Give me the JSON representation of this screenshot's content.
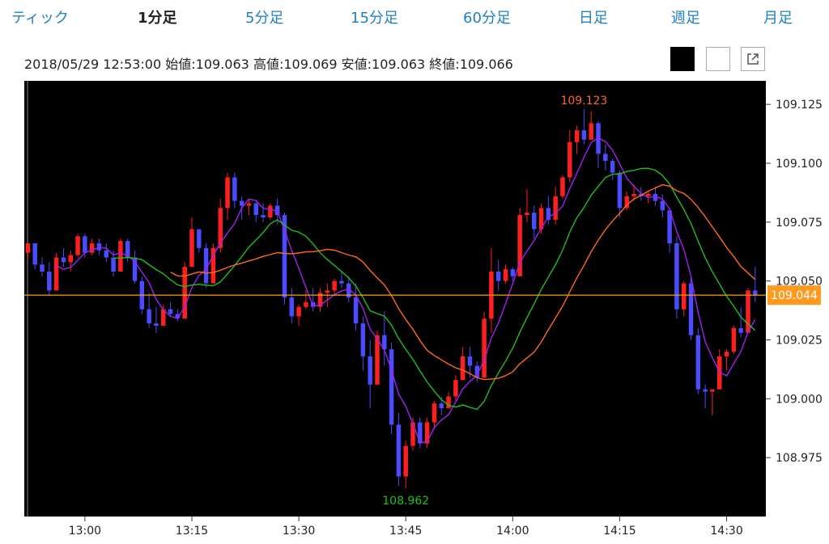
{
  "tabs": [
    {
      "label": "ティック",
      "active": false
    },
    {
      "label": "1分足",
      "active": true
    },
    {
      "label": "5分足",
      "active": false
    },
    {
      "label": "15分足",
      "active": false
    },
    {
      "label": "60分足",
      "active": false
    },
    {
      "label": "日足",
      "active": false
    },
    {
      "label": "週足",
      "active": false
    },
    {
      "label": "月足",
      "active": false
    }
  ],
  "ohlc_bar": {
    "datetime": "2018/05/29 12:53:00",
    "open_label": "始値",
    "open": "109.063",
    "high_label": "高値",
    "high": "109.069",
    "low_label": "安値",
    "low": "109.063",
    "close_label": "終値",
    "close": "109.066"
  },
  "buttons": {
    "theme_dark": "black-theme",
    "theme_light": "white-theme",
    "popout": "external-link-icon"
  },
  "chart_data": {
    "type": "candlestick",
    "interval": "1分足",
    "y_ticks": [
      "109.125",
      "109.100",
      "109.075",
      "109.050",
      "109.025",
      "109.000",
      "108.975"
    ],
    "ylim": [
      108.95,
      109.135
    ],
    "x_ticks": [
      "13:00",
      "13:15",
      "13:30",
      "13:45",
      "14:00",
      "14:15",
      "14:30"
    ],
    "x_tick_index": [
      8,
      23,
      38,
      53,
      68,
      83,
      98
    ],
    "current_price": "109.044",
    "annotations": {
      "high": "109.123",
      "low": "108.962"
    },
    "colors": {
      "up": "#ff1f1f",
      "down": "#4b4bff",
      "ma_short": "#a020f0",
      "ma_mid": "#1fbf1f",
      "ma_long": "#ff6a1a",
      "price_line": "#ff9a1f",
      "high_label": "#ff6a1a",
      "low_label": "#1fbf1f"
    },
    "candles": [
      [
        109.062,
        109.066,
        109.059,
        109.066
      ],
      [
        109.066,
        109.066,
        109.055,
        109.057
      ],
      [
        109.057,
        109.06,
        109.052,
        109.054
      ],
      [
        109.054,
        109.058,
        109.044,
        109.046
      ],
      [
        109.046,
        109.062,
        109.046,
        109.06
      ],
      [
        109.06,
        109.064,
        109.056,
        109.058
      ],
      [
        109.058,
        109.063,
        109.054,
        109.061
      ],
      [
        109.061,
        109.07,
        109.06,
        109.069
      ],
      [
        109.069,
        109.07,
        109.06,
        109.062
      ],
      [
        109.062,
        109.068,
        109.061,
        109.066
      ],
      [
        109.066,
        109.068,
        109.061,
        109.063
      ],
      [
        109.063,
        109.066,
        109.058,
        109.06
      ],
      [
        109.06,
        109.063,
        109.052,
        109.054
      ],
      [
        109.054,
        109.068,
        109.054,
        109.067
      ],
      [
        109.067,
        109.068,
        109.058,
        109.06
      ],
      [
        109.06,
        109.063,
        109.049,
        109.05
      ],
      [
        109.05,
        109.052,
        109.036,
        109.038
      ],
      [
        109.038,
        109.045,
        109.03,
        109.032
      ],
      [
        109.032,
        109.039,
        109.028,
        109.031
      ],
      [
        109.031,
        109.04,
        109.031,
        109.038
      ],
      [
        109.038,
        109.041,
        109.035,
        109.036
      ],
      [
        109.036,
        109.038,
        109.033,
        109.034
      ],
      [
        109.034,
        109.058,
        109.034,
        109.056
      ],
      [
        109.056,
        109.077,
        109.056,
        109.072
      ],
      [
        109.072,
        109.072,
        109.062,
        109.064
      ],
      [
        109.064,
        109.066,
        109.047,
        109.049
      ],
      [
        109.049,
        109.066,
        109.049,
        109.064
      ],
      [
        109.064,
        109.085,
        109.062,
        109.081
      ],
      [
        109.081,
        109.096,
        109.076,
        109.094
      ],
      [
        109.094,
        109.096,
        109.081,
        109.084
      ],
      [
        109.084,
        109.086,
        109.076,
        109.082
      ],
      [
        109.082,
        109.085,
        109.078,
        109.083
      ],
      [
        109.083,
        109.084,
        109.075,
        109.078
      ],
      [
        109.078,
        109.083,
        109.075,
        109.077
      ],
      [
        109.077,
        109.083,
        109.076,
        109.082
      ],
      [
        109.082,
        109.085,
        109.074,
        109.078
      ],
      [
        109.078,
        109.079,
        109.04,
        109.043
      ],
      [
        109.043,
        109.047,
        109.032,
        109.035
      ],
      [
        109.035,
        109.04,
        109.031,
        109.039
      ],
      [
        109.039,
        109.046,
        109.038,
        109.041
      ],
      [
        109.041,
        109.047,
        109.037,
        109.039
      ],
      [
        109.039,
        109.047,
        109.037,
        109.045
      ],
      [
        109.045,
        109.049,
        109.039,
        109.046
      ],
      [
        109.046,
        109.051,
        109.044,
        109.05
      ],
      [
        109.05,
        109.054,
        109.047,
        109.049
      ],
      [
        109.049,
        109.052,
        109.041,
        109.043
      ],
      [
        109.043,
        109.049,
        109.029,
        109.032
      ],
      [
        109.032,
        109.035,
        109.012,
        109.018
      ],
      [
        109.018,
        109.025,
        108.996,
        109.006
      ],
      [
        109.006,
        109.029,
        109.006,
        109.027
      ],
      [
        109.027,
        109.037,
        109.014,
        109.021
      ],
      [
        109.021,
        109.024,
        108.985,
        108.989
      ],
      [
        108.989,
        108.994,
        108.963,
        108.967
      ],
      [
        108.967,
        108.982,
        108.962,
        108.98
      ],
      [
        108.98,
        108.992,
        108.978,
        108.99
      ],
      [
        108.99,
        108.992,
        108.979,
        108.981
      ],
      [
        108.981,
        108.992,
        108.979,
        108.99
      ],
      [
        108.99,
        108.999,
        108.987,
        108.998
      ],
      [
        108.998,
        109.001,
        108.993,
        108.996
      ],
      [
        108.996,
        109.003,
        108.996,
        109.001
      ],
      [
        109.001,
        109.01,
        108.999,
        109.008
      ],
      [
        109.008,
        109.022,
        109.008,
        109.018
      ],
      [
        109.018,
        109.022,
        109.009,
        109.014
      ],
      [
        109.014,
        109.016,
        109.007,
        109.009
      ],
      [
        109.009,
        109.037,
        109.009,
        109.034
      ],
      [
        109.034,
        109.064,
        109.028,
        109.054
      ],
      [
        109.054,
        109.059,
        109.046,
        109.05
      ],
      [
        109.05,
        109.057,
        109.049,
        109.055
      ],
      [
        109.055,
        109.056,
        109.05,
        109.052
      ],
      [
        109.052,
        109.081,
        109.052,
        109.078
      ],
      [
        109.078,
        109.089,
        109.075,
        109.079
      ],
      [
        109.079,
        109.082,
        109.068,
        109.072
      ],
      [
        109.072,
        109.083,
        109.07,
        109.081
      ],
      [
        109.081,
        109.086,
        109.074,
        109.076
      ],
      [
        109.076,
        109.09,
        109.074,
        109.086
      ],
      [
        109.086,
        109.095,
        109.085,
        109.094
      ],
      [
        109.094,
        109.114,
        109.092,
        109.109
      ],
      [
        109.109,
        109.116,
        109.104,
        109.114
      ],
      [
        109.114,
        109.123,
        109.108,
        109.11
      ],
      [
        109.11,
        109.122,
        109.11,
        109.117
      ],
      [
        109.117,
        109.118,
        109.098,
        109.104
      ],
      [
        109.104,
        109.108,
        109.097,
        109.101
      ],
      [
        109.101,
        109.102,
        109.093,
        109.096
      ],
      [
        109.096,
        109.097,
        109.077,
        109.081
      ],
      [
        109.081,
        109.088,
        109.08,
        109.086
      ],
      [
        109.086,
        109.091,
        109.084,
        109.087
      ],
      [
        109.087,
        109.09,
        109.084,
        109.086
      ],
      [
        109.086,
        109.088,
        109.083,
        109.087
      ],
      [
        109.087,
        109.09,
        109.082,
        109.084
      ],
      [
        109.084,
        109.087,
        109.077,
        109.08
      ],
      [
        109.08,
        109.081,
        109.062,
        109.066
      ],
      [
        109.066,
        109.069,
        109.034,
        109.038
      ],
      [
        109.038,
        109.05,
        109.035,
        109.049
      ],
      [
        109.049,
        109.051,
        109.025,
        109.027
      ],
      [
        109.027,
        109.03,
        109.002,
        109.004
      ],
      [
        109.004,
        109.006,
        108.996,
        109.003
      ],
      [
        109.003,
        109.004,
        108.993,
        109.004
      ],
      [
        109.004,
        109.021,
        109.004,
        109.018
      ],
      [
        109.018,
        109.021,
        109.012,
        109.02
      ],
      [
        109.02,
        109.031,
        109.019,
        109.03
      ],
      [
        109.03,
        109.039,
        109.026,
        109.028
      ],
      [
        109.028,
        109.047,
        109.028,
        109.046
      ],
      [
        109.046,
        109.056,
        109.041,
        109.044
      ]
    ]
  }
}
